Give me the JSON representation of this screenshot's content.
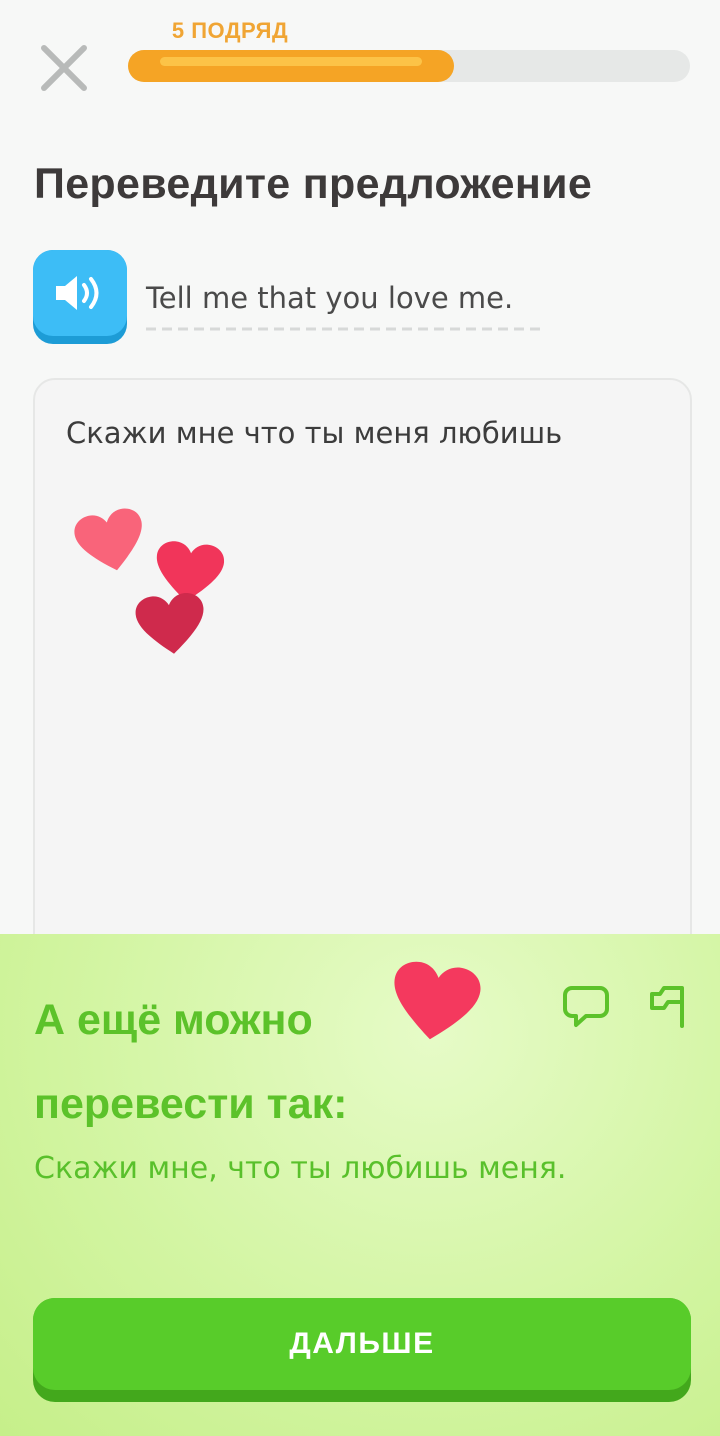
{
  "header": {
    "streak_label": "5 ПОДРЯД",
    "progress": 0.58
  },
  "exercise": {
    "title": "Переведите предложение",
    "prompt_sentence": "Tell me that you love me.",
    "user_answer": "Скажи мне что ты меня любишь"
  },
  "feedback": {
    "title": "А ещё можно перевести так:",
    "alternative_translation": "Скажи мне, что ты любишь меня.",
    "continue_label": "ДАЛЬШЕ"
  },
  "colors": {
    "accent_orange": "#f5a425",
    "speaker_blue": "#3dbdf6",
    "success_green": "#58cc2a",
    "feedback_text_green": "#5cc22a",
    "heart_red": "#f4395e"
  },
  "icons": [
    "close-icon",
    "speaker-icon",
    "heart-icon",
    "comment-icon",
    "flag-icon"
  ]
}
